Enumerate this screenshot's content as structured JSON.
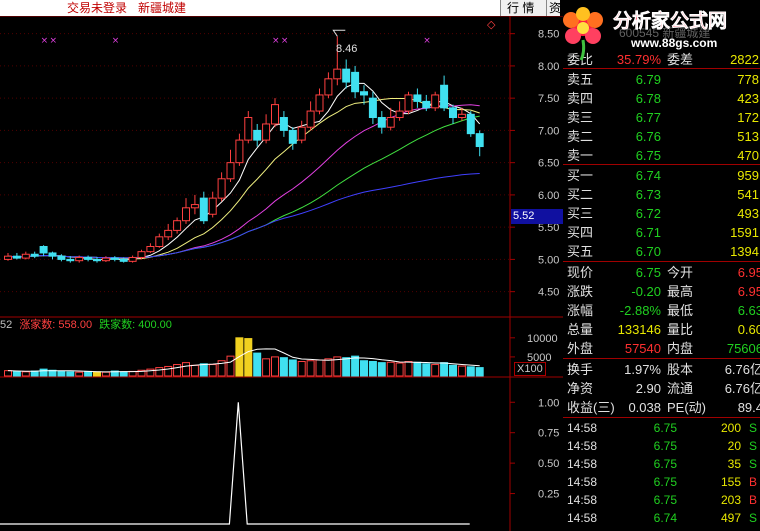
{
  "topbar": {
    "trade_status": "交易未登录",
    "stock_name": "新疆城建",
    "menu_tabs": [
      "行 情",
      "资"
    ]
  },
  "logo": {
    "title": "分析家公式网",
    "url": "www.88gs.com"
  },
  "chart": {
    "high_label": "8.46",
    "current_price_tag": "5.52",
    "price_axis": [
      "8.50",
      "8.00",
      "7.50",
      "7.00",
      "6.50",
      "6.00",
      "5.50",
      "5.00",
      "4.50"
    ],
    "volume_axis": [
      "10000",
      "5000"
    ],
    "volume_unit": "X100",
    "indicator_axis": [
      "1.00",
      "0.75",
      "0.50",
      "0.25"
    ],
    "legend": {
      "prefix": "52",
      "up_label": "涨家数: 558.00",
      "down_label": "跌家数: 400.00"
    },
    "colors": {
      "up": "#ff4040",
      "down": "#40e0f0",
      "ma5": "#ffffff",
      "ma10": "#f0f080",
      "ma20": "#e040e0",
      "ma30": "#40e040",
      "ma60": "#4040ff"
    }
  },
  "chart_data": {
    "type": "candlestick",
    "candles": [
      {
        "o": 5.0,
        "c": 5.05,
        "h": 5.1,
        "l": 4.98
      },
      {
        "o": 5.05,
        "c": 5.02,
        "h": 5.1,
        "l": 5.0
      },
      {
        "o": 5.02,
        "c": 5.08,
        "h": 5.12,
        "l": 5.0
      },
      {
        "o": 5.08,
        "c": 5.05,
        "h": 5.12,
        "l": 5.02
      },
      {
        "o": 5.2,
        "c": 5.1,
        "h": 5.22,
        "l": 5.05
      },
      {
        "o": 5.1,
        "c": 5.05,
        "h": 5.12,
        "l": 5.0
      },
      {
        "o": 5.05,
        "c": 5.0,
        "h": 5.08,
        "l": 4.97
      },
      {
        "o": 5.0,
        "c": 4.98,
        "h": 5.05,
        "l": 4.95
      },
      {
        "o": 4.98,
        "c": 5.03,
        "h": 5.06,
        "l": 4.95
      },
      {
        "o": 5.03,
        "c": 5.0,
        "h": 5.06,
        "l": 4.97
      },
      {
        "o": 5.0,
        "c": 4.98,
        "h": 5.04,
        "l": 4.95
      },
      {
        "o": 4.98,
        "c": 5.02,
        "h": 5.05,
        "l": 4.96
      },
      {
        "o": 5.02,
        "c": 5.0,
        "h": 5.05,
        "l": 4.97
      },
      {
        "o": 5.0,
        "c": 4.97,
        "h": 5.03,
        "l": 4.95
      },
      {
        "o": 4.97,
        "c": 5.03,
        "h": 5.06,
        "l": 4.95
      },
      {
        "o": 5.03,
        "c": 5.12,
        "h": 5.15,
        "l": 5.0
      },
      {
        "o": 5.12,
        "c": 5.2,
        "h": 5.25,
        "l": 5.1
      },
      {
        "o": 5.2,
        "c": 5.35,
        "h": 5.4,
        "l": 5.18
      },
      {
        "o": 5.35,
        "c": 5.45,
        "h": 5.55,
        "l": 5.3
      },
      {
        "o": 5.45,
        "c": 5.6,
        "h": 5.65,
        "l": 5.4
      },
      {
        "o": 5.6,
        "c": 5.8,
        "h": 5.95,
        "l": 5.55
      },
      {
        "o": 5.8,
        "c": 5.85,
        "h": 6.0,
        "l": 5.7
      },
      {
        "o": 5.95,
        "c": 5.6,
        "h": 6.05,
        "l": 5.55
      },
      {
        "o": 5.7,
        "c": 5.95,
        "h": 6.05,
        "l": 5.65
      },
      {
        "o": 5.95,
        "c": 6.25,
        "h": 6.35,
        "l": 5.9
      },
      {
        "o": 6.25,
        "c": 6.5,
        "h": 6.7,
        "l": 6.2
      },
      {
        "o": 6.5,
        "c": 6.85,
        "h": 6.95,
        "l": 6.45
      },
      {
        "o": 6.85,
        "c": 7.2,
        "h": 7.3,
        "l": 6.8
      },
      {
        "o": 7.0,
        "c": 6.85,
        "h": 7.1,
        "l": 6.75
      },
      {
        "o": 6.85,
        "c": 7.1,
        "h": 7.25,
        "l": 6.8
      },
      {
        "o": 7.1,
        "c": 7.4,
        "h": 7.5,
        "l": 7.05
      },
      {
        "o": 7.2,
        "c": 7.0,
        "h": 7.3,
        "l": 6.9
      },
      {
        "o": 7.0,
        "c": 6.8,
        "h": 7.05,
        "l": 6.7
      },
      {
        "o": 6.85,
        "c": 7.05,
        "h": 7.15,
        "l": 6.8
      },
      {
        "o": 7.05,
        "c": 7.3,
        "h": 7.45,
        "l": 7.0
      },
      {
        "o": 7.3,
        "c": 7.55,
        "h": 7.65,
        "l": 7.25
      },
      {
        "o": 7.55,
        "c": 7.8,
        "h": 7.9,
        "l": 7.5
      },
      {
        "o": 7.8,
        "c": 7.95,
        "h": 8.46,
        "l": 7.7
      },
      {
        "o": 7.95,
        "c": 7.75,
        "h": 8.1,
        "l": 7.65
      },
      {
        "o": 7.9,
        "c": 7.6,
        "h": 8.0,
        "l": 7.5
      },
      {
        "o": 7.6,
        "c": 7.55,
        "h": 7.7,
        "l": 7.4
      },
      {
        "o": 7.5,
        "c": 7.2,
        "h": 7.6,
        "l": 7.1
      },
      {
        "o": 7.2,
        "c": 7.05,
        "h": 7.3,
        "l": 6.95
      },
      {
        "o": 7.05,
        "c": 7.2,
        "h": 7.35,
        "l": 7.0
      },
      {
        "o": 7.2,
        "c": 7.3,
        "h": 7.45,
        "l": 7.15
      },
      {
        "o": 7.3,
        "c": 7.55,
        "h": 7.6,
        "l": 7.25
      },
      {
        "o": 7.55,
        "c": 7.45,
        "h": 7.65,
        "l": 7.35
      },
      {
        "o": 7.45,
        "c": 7.35,
        "h": 7.55,
        "l": 7.3
      },
      {
        "o": 7.35,
        "c": 7.55,
        "h": 7.6,
        "l": 7.3
      },
      {
        "o": 7.7,
        "c": 7.35,
        "h": 7.85,
        "l": 7.3
      },
      {
        "o": 7.35,
        "c": 7.2,
        "h": 7.4,
        "l": 7.1
      },
      {
        "o": 7.2,
        "c": 7.25,
        "h": 7.35,
        "l": 7.15
      },
      {
        "o": 7.25,
        "c": 6.95,
        "h": 7.3,
        "l": 6.9
      },
      {
        "o": 6.95,
        "c": 6.75,
        "h": 7.0,
        "l": 6.6
      }
    ],
    "volumes": [
      1400,
      1200,
      1100,
      1300,
      1800,
      1500,
      1200,
      1100,
      1000,
      1200,
      1100,
      1000,
      1300,
      1100,
      1200,
      1500,
      1800,
      2200,
      2500,
      3000,
      3500,
      2800,
      3200,
      3000,
      4000,
      5200,
      10000,
      9800,
      6000,
      4500,
      5000,
      4800,
      4200,
      3800,
      4000,
      4200,
      4500,
      5000,
      4800,
      5200,
      4000,
      3800,
      3500,
      3600,
      3400,
      3800,
      3600,
      3200,
      3000,
      3500,
      2800,
      2600,
      2400,
      2200
    ],
    "volume_highlight_index": [
      10,
      26,
      27
    ],
    "indicator": [
      0.0,
      0.0,
      0.0,
      0.0,
      0.0,
      0.0,
      0.0,
      0.0,
      0.0,
      0.0,
      0.0,
      0.0,
      0.0,
      0.0,
      0.0,
      0.0,
      0.0,
      0.0,
      0.0,
      0.0,
      0.0,
      0.0,
      0.0,
      0.0,
      0.0,
      0.0,
      0.0,
      1.0,
      0.0,
      0.0,
      0.0,
      0.0,
      0.0,
      0.0,
      0.0,
      0.0,
      0.0,
      0.0,
      0.0,
      0.0,
      0.0,
      0.0,
      0.0,
      0.0,
      0.0,
      0.0,
      0.0,
      0.0,
      0.0,
      0.0,
      0.0,
      0.0,
      0.0,
      0.0
    ],
    "ylim_price": [
      4.2,
      8.65
    ],
    "ylim_volume": [
      0,
      11000
    ],
    "ylim_indicator": [
      0,
      1.15
    ]
  },
  "panel": {
    "header_code": "600545 新疆城建",
    "ratio_label": "委比",
    "ratio_value": "35.79%",
    "diff_label": "委差",
    "diff_value": "2822",
    "asks": [
      {
        "label": "卖五",
        "price": "6.79",
        "vol": "778"
      },
      {
        "label": "卖四",
        "price": "6.78",
        "vol": "423"
      },
      {
        "label": "卖三",
        "price": "6.77",
        "vol": "172"
      },
      {
        "label": "卖二",
        "price": "6.76",
        "vol": "513"
      },
      {
        "label": "卖一",
        "price": "6.75",
        "vol": "470"
      }
    ],
    "bids": [
      {
        "label": "买一",
        "price": "6.74",
        "vol": "959"
      },
      {
        "label": "买二",
        "price": "6.73",
        "vol": "541"
      },
      {
        "label": "买三",
        "price": "6.72",
        "vol": "493"
      },
      {
        "label": "买四",
        "price": "6.71",
        "vol": "1591"
      },
      {
        "label": "买五",
        "price": "6.70",
        "vol": "1394"
      }
    ],
    "stats": [
      {
        "l1": "现价",
        "v1": "6.75",
        "c1": "#20d020",
        "l2": "今开",
        "v2": "6.95",
        "c2": "#ff3030"
      },
      {
        "l1": "涨跌",
        "v1": "-0.20",
        "c1": "#20d020",
        "l2": "最高",
        "v2": "6.95",
        "c2": "#ff3030"
      },
      {
        "l1": "涨幅",
        "v1": "-2.88%",
        "c1": "#20d020",
        "l2": "最低",
        "v2": "6.63",
        "c2": "#20d020"
      },
      {
        "l1": "总量",
        "v1": "133146",
        "c1": "#e8e800",
        "l2": "量比",
        "v2": "0.60",
        "c2": "#e8e800"
      },
      {
        "l1": "外盘",
        "v1": "57540",
        "c1": "#ff3030",
        "l2": "内盘",
        "v2": "75606",
        "c2": "#20d020"
      }
    ],
    "stats2": [
      {
        "l1": "换手",
        "v1": "1.97%",
        "l2": "股本",
        "v2": "6.76亿"
      },
      {
        "l1": "净资",
        "v1": "2.90",
        "l2": "流通",
        "v2": "6.76亿"
      },
      {
        "l1": "收益(三)",
        "v1": "0.038",
        "l2": "PE(动)",
        "v2": "89.4"
      }
    ],
    "ticks": [
      {
        "time": "14:58",
        "price": "6.75",
        "vol": "200",
        "side": "S"
      },
      {
        "time": "14:58",
        "price": "6.75",
        "vol": "20",
        "side": "S"
      },
      {
        "time": "14:58",
        "price": "6.75",
        "vol": "35",
        "side": "S"
      },
      {
        "time": "14:58",
        "price": "6.75",
        "vol": "155",
        "side": "B"
      },
      {
        "time": "14:58",
        "price": "6.75",
        "vol": "203",
        "side": "B"
      },
      {
        "time": "14:58",
        "price": "6.74",
        "vol": "497",
        "side": "S"
      }
    ]
  }
}
